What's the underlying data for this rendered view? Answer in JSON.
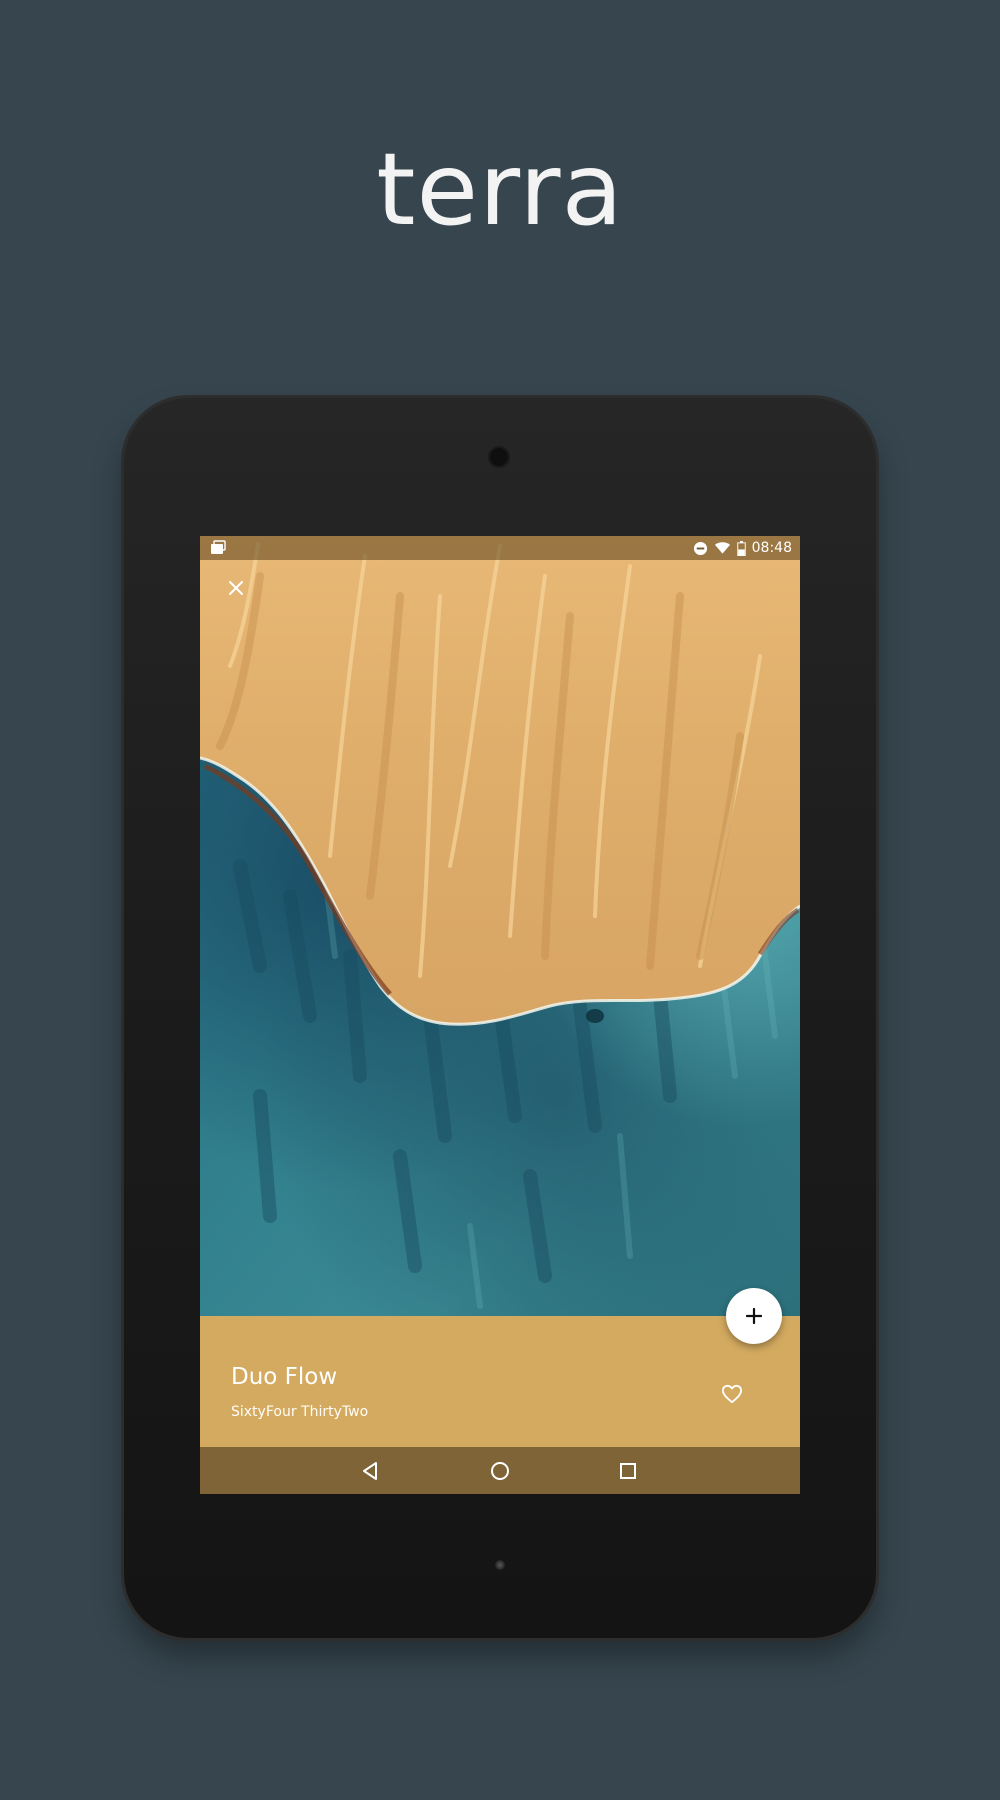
{
  "headline": "terra",
  "status_bar": {
    "time": "08:48",
    "icons": [
      "notification-icon",
      "do-not-disturb-icon",
      "wifi-icon",
      "battery-icon"
    ]
  },
  "wallpaper": {
    "title": "Duo Flow",
    "author": "SixtyFour ThirtyTwo"
  },
  "actions": {
    "close_icon": "close-icon",
    "favorite_icon": "heart-icon",
    "add_icon": "plus-icon"
  },
  "navigation": {
    "buttons": [
      "back-icon",
      "home-icon",
      "recents-icon"
    ]
  },
  "colors": {
    "background": "#36454e",
    "info_panel": "#d4aa60",
    "nav_bar": "#7f6437",
    "sand": "#dcae6a",
    "water": "#2d6b7c"
  }
}
